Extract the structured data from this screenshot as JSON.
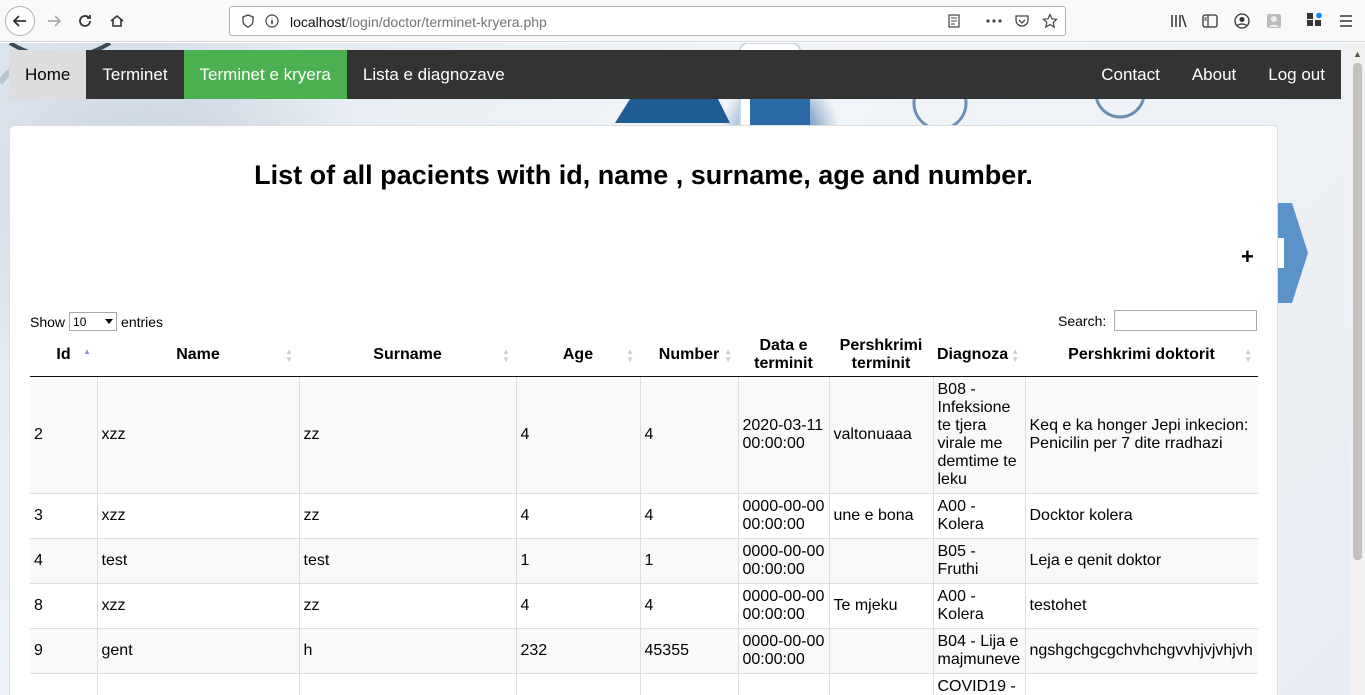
{
  "browser": {
    "url_host": "localhost",
    "url_path": "/login/doctor/terminet-kryera.php"
  },
  "nav": {
    "left": [
      "Home",
      "Terminet",
      "Terminet e kryera",
      "Lista e diagnozave"
    ],
    "right": [
      "Contact",
      "About",
      "Log out"
    ],
    "active_color": "#4caf50"
  },
  "page": {
    "heading": "List of all pacients with id, name , surname, age and number.",
    "plus": "+",
    "show_label": "Show",
    "entries_value": "10",
    "entries_label": "entries",
    "search_label": "Search:"
  },
  "table": {
    "headers": [
      "Id",
      "Name",
      "Surname",
      "Age",
      "Number",
      "Data e terminit",
      "Pershkrimi terminit",
      "Diagnoza",
      "Pershkrimi doktorit"
    ],
    "rows": [
      [
        "2",
        "xzz",
        "zz",
        "4",
        "4",
        "2020-03-11 00:00:00",
        "valtonuaaa",
        "B08 - Infeksione te tjera virale me demtime te leku",
        "Keq e ka honger Jepi inkecion: Penicilin per 7 dite rradhazi"
      ],
      [
        "3",
        "xzz",
        "zz",
        "4",
        "4",
        "0000-00-00 00:00:00",
        "une e bona",
        "A00 - Kolera",
        "Docktor kolera"
      ],
      [
        "4",
        "test",
        "test",
        "1",
        "1",
        "0000-00-00 00:00:00",
        "",
        "B05 - Fruthi",
        "Leja e qenit doktor"
      ],
      [
        "8",
        "xzz",
        "zz",
        "4",
        "4",
        "0000-00-00 00:00:00",
        "Te mjeku",
        "A00 - Kolera",
        "testohet"
      ],
      [
        "9",
        "gent",
        "h",
        "232",
        "45355",
        "0000-00-00 00:00:00",
        "",
        "B04 - Lija e majmuneve",
        "ngshgchgcgchvhchgvvhjvjvhjvh"
      ],
      [
        "",
        "",
        "",
        "",
        "",
        "",
        "",
        "COVID19 -",
        ""
      ]
    ]
  }
}
